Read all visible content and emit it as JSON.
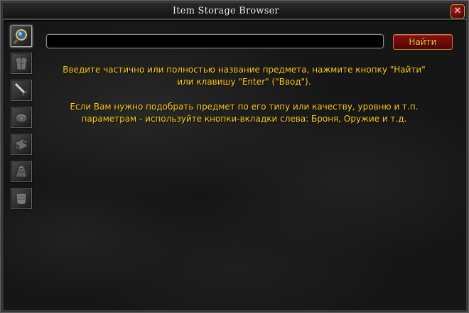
{
  "window": {
    "title": "Item Storage Browser",
    "close_label": "✕"
  },
  "tabs": [
    {
      "name": "search",
      "icon": "magnifier-icon",
      "active": true
    },
    {
      "name": "armor",
      "icon": "chest-armor-icon",
      "active": false
    },
    {
      "name": "weapon",
      "icon": "sword-icon",
      "active": false
    },
    {
      "name": "misc",
      "icon": "bundle-icon",
      "active": false
    },
    {
      "name": "scroll",
      "icon": "scroll-icon",
      "active": false
    },
    {
      "name": "container",
      "icon": "bag-icon",
      "active": false
    },
    {
      "name": "cloth",
      "icon": "cloth-icon",
      "active": false
    }
  ],
  "search": {
    "value": "",
    "button_label": "Найти"
  },
  "help": {
    "line1": "Введите частично или полностью название предмета, нажмите кнопку \"Найти\"",
    "line2": "или клавишу \"Enter\" (\"Ввод\").",
    "line3": "Если Вам нужно подобрать предмет по его типу или качеству, уровню и т.п.",
    "line4": "параметрам - используйте кнопки-вкладки слева: Броня, Оружие и т.д."
  },
  "colors": {
    "text_gold": "#ffd100",
    "button_red": "#8c0f0f"
  }
}
